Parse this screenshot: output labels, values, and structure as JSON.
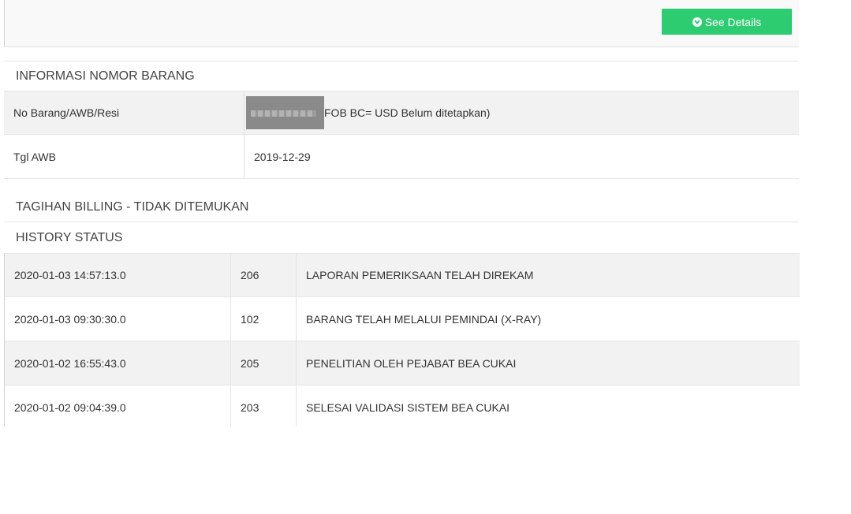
{
  "header": {
    "details_button": "See Details",
    "details_icon": "chevron-circle-down-icon",
    "accent": "#2ecc71"
  },
  "item_info": {
    "title": "INFORMASI NOMOR BARANG",
    "rows": [
      {
        "label": "No Barang/AWB/Resi",
        "value": "FOB BC= USD Belum ditetapkan)"
      },
      {
        "label": "Tgl AWB",
        "value": "2019-12-29"
      }
    ]
  },
  "billing": {
    "title": "TAGIHAN BILLING - TIDAK DITEMUKAN"
  },
  "history": {
    "title": "HISTORY STATUS",
    "rows": [
      {
        "time": "2020-01-03 14:57:13.0",
        "code": "206",
        "status": "LAPORAN PEMERIKSAAN TELAH DIREKAM"
      },
      {
        "time": "2020-01-03 09:30:30.0",
        "code": "102",
        "status": "BARANG TELAH MELALUI PEMINDAI (X-RAY)"
      },
      {
        "time": "2020-01-02 16:55:43.0",
        "code": "205",
        "status": "PENELITIAN OLEH PEJABAT BEA CUKAI"
      },
      {
        "time": "2020-01-02 09:04:39.0",
        "code": "203",
        "status": "SELESAI VALIDASI SISTEM BEA CUKAI"
      }
    ]
  }
}
